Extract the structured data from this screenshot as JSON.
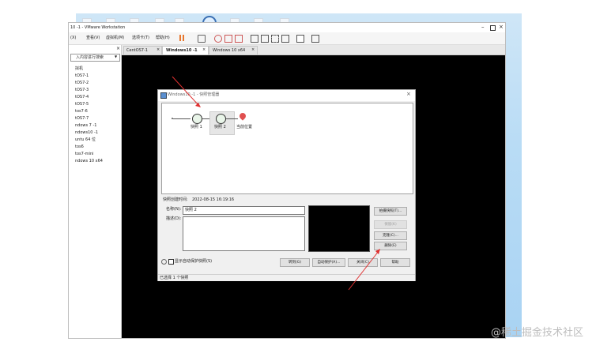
{
  "window": {
    "title": "10 -1 - VMware Workstation"
  },
  "menu": [
    "(X)",
    "查看(V)",
    "虚拟机(M)",
    "选项卡(T)",
    "帮助(H)"
  ],
  "library": {
    "search_placeholder": "入内容进行搜索",
    "items": [
      "拟机",
      "tOS7-1",
      "tOS7-2",
      "tOS7-3",
      "tOS7-4",
      "tOS7-5",
      "tos7-6",
      "tOS7-7",
      "ndows 7 -1",
      "ndows10 -1",
      "untu 64 位",
      "tos6",
      "tos7-mini",
      "ndows 10 x64"
    ]
  },
  "tabs": [
    "CentOS7-1",
    "Windows10 -1",
    "Windows 10 x64"
  ],
  "dialog": {
    "title": "Windows10 -1 - 快照管理器",
    "nodes": [
      "快照 1",
      "快照 2",
      "当前位置"
    ],
    "created_label": "快照创建时间:",
    "created_value": "2022-08-15 16:19:16",
    "name_label": "名称(N):",
    "name_value": "快照 2",
    "desc_label": "描述(D):",
    "desc_value": "",
    "side_buttons": [
      "拍摄快照(T)...",
      "保留(K)",
      "克隆(C)...",
      "删除(E)"
    ],
    "autoprotect_label": "显示自动保护快照(S)",
    "bottom_buttons": [
      "转到(G)",
      "自动保护(A)...",
      "关闭(C)",
      "帮助"
    ],
    "status": "已选择 1 个快照"
  },
  "watermark": "@稀土掘金技术社区",
  "colors": {
    "desktop": "#b9dcf5",
    "vm_screen": "#000000",
    "arrow": "#e03030",
    "accent": "#4a7fc0"
  },
  "icons": [
    "pause-icon",
    "send-keys-icon",
    "snapshot-icon",
    "revert-icon",
    "manager-icon",
    "view-icon",
    "fullscreen-icon",
    "console-icon",
    "settings-icon",
    "close-icon",
    "maximize-icon",
    "minimize-icon"
  ]
}
